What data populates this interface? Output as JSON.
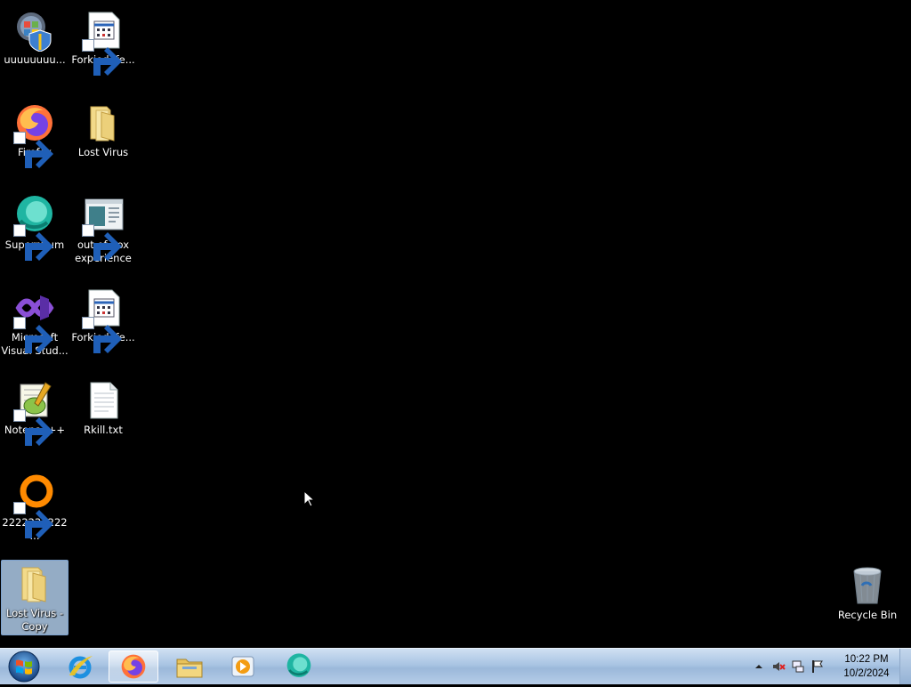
{
  "desktop": {
    "icons": [
      {
        "name": "uuuuuuuu...",
        "icon": "windows-update-icon"
      },
      {
        "name": "Forkiedefe...",
        "icon": "calendar-doc-icon"
      },
      {
        "name": "Firefox",
        "icon": "firefox-icon"
      },
      {
        "name": "Lost Virus",
        "icon": "folder-icon"
      },
      {
        "name": "Supermium",
        "icon": "supermium-icon"
      },
      {
        "name": "out of box experience",
        "icon": "window-app-icon"
      },
      {
        "name": "Microsoft Visual Stud...",
        "icon": "visual-studio-icon"
      },
      {
        "name": "Forkiedefe...",
        "icon": "calendar-doc-icon"
      },
      {
        "name": "Notepad++",
        "icon": "notepadpp-icon"
      },
      {
        "name": "Rkill.txt",
        "icon": "text-file-icon"
      },
      {
        "name": "2222222222...",
        "icon": "orange-ring-icon"
      },
      {
        "name": "Lost Virus - Copy",
        "icon": "folder-icon",
        "selected": true
      },
      {
        "name": "Recycle Bin",
        "icon": "recycle-bin-icon"
      }
    ]
  },
  "taskbar": {
    "pinned": [
      "internet-explorer-icon",
      "firefox-icon",
      "file-explorer-icon",
      "media-player-icon",
      "supermium-icon"
    ],
    "active": "firefox-icon",
    "tray": [
      "show-hidden-icons-icon",
      "volume-muted-icon",
      "network-icon",
      "action-center-flag-icon"
    ],
    "clock": {
      "time": "10:22 PM",
      "date": "10/2/2024"
    }
  }
}
